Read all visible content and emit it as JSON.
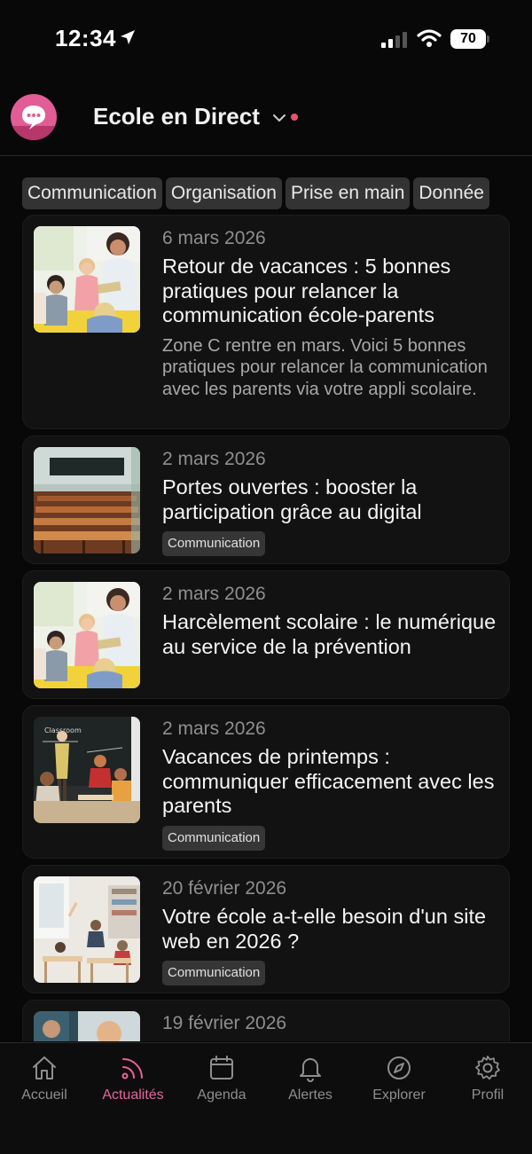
{
  "status_bar": {
    "time": "12:34",
    "battery": "70",
    "icons": [
      "location-arrow-icon",
      "cellular-signal-icon",
      "wifi-icon",
      "battery-icon"
    ]
  },
  "header": {
    "title": "Ecole en Direct",
    "logo_icon": "chat-bubble-icon",
    "accent_color": "#e25c95",
    "notification_dot_color": "#f0506e"
  },
  "categories": [
    {
      "label": "Communication"
    },
    {
      "label": "Organisation"
    },
    {
      "label": "Prise en main"
    },
    {
      "label": "Donnée"
    }
  ],
  "articles": [
    {
      "date": "6 mars 2026",
      "title": "Retour de vacances : 5 bonnes pratiques pour relancer la communication école-parents",
      "description": "Zone C rentre en mars. Voici 5 bonnes pratiques pour relancer la communication avec les parents via votre appli scolaire.",
      "tag": ""
    },
    {
      "date": "2 mars 2026",
      "title": "Portes ouvertes : booster la participation grâce au digital",
      "description": "",
      "tag": "Communication"
    },
    {
      "date": "2 mars 2026",
      "title": "Harcèlement scolaire : le numérique au service de la prévention",
      "description": "",
      "tag": ""
    },
    {
      "date": "2 mars 2026",
      "title": "Vacances de printemps : communiquer efficacement avec les parents",
      "description": "",
      "tag": "Communication"
    },
    {
      "date": "20 février 2026",
      "title": "Votre école a-t-elle besoin d'un site web en 2026 ?",
      "description": "",
      "tag": "Communication"
    },
    {
      "date": "19 février 2026",
      "title": "",
      "description": "",
      "tag": ""
    }
  ],
  "tabbar": {
    "active_color": "#e8649a",
    "items": [
      {
        "label": "Accueil",
        "icon": "home-icon"
      },
      {
        "label": "Actualités",
        "icon": "rss-feed-icon"
      },
      {
        "label": "Agenda",
        "icon": "calendar-icon"
      },
      {
        "label": "Alertes",
        "icon": "bell-icon"
      },
      {
        "label": "Explorer",
        "icon": "compass-icon"
      },
      {
        "label": "Profil",
        "icon": "gear-icon"
      }
    ]
  }
}
